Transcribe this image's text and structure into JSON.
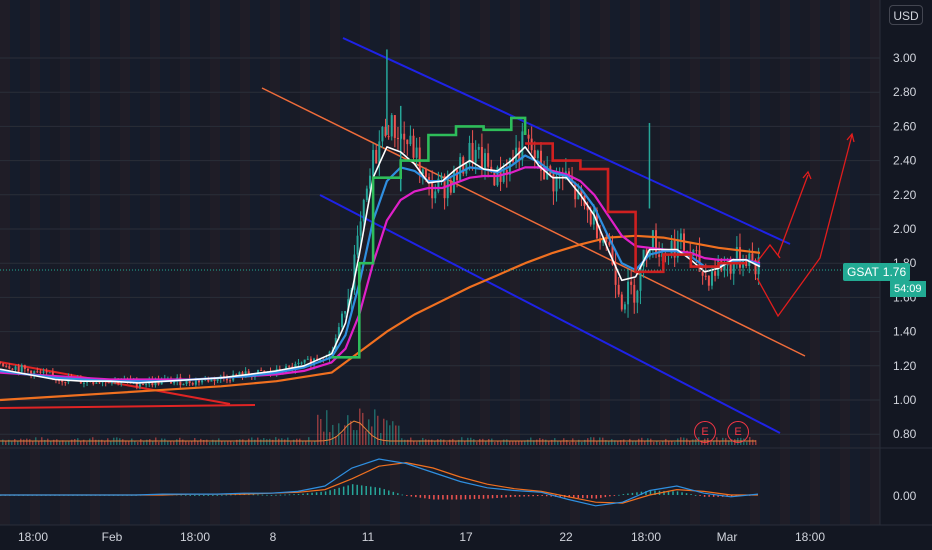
{
  "currency_label": "USD",
  "price_tag": {
    "symbol": "GSAT",
    "value": "1.76",
    "countdown": "54:09"
  },
  "earnings": {
    "label": "E"
  },
  "chart_data": {
    "type": "candlestick",
    "ticker": "GSAT",
    "y_ticks": [
      "3.00",
      "2.80",
      "2.60",
      "2.40",
      "2.20",
      "2.00",
      "1.80",
      "1.60",
      "1.40",
      "1.20",
      "1.00",
      "0.80"
    ],
    "macd_ticks": [
      "0.00"
    ],
    "x_ticks": [
      "18:00",
      "Feb",
      "18:00",
      "8",
      "11",
      "17",
      "22",
      "18:00",
      "Mar",
      "18:00"
    ],
    "ylim": [
      0.75,
      3.1
    ],
    "last_price": 1.76,
    "price_path": [
      [
        0,
        1.22
      ],
      [
        4,
        1.17
      ],
      [
        8,
        1.13
      ],
      [
        12,
        1.11
      ],
      [
        16,
        1.12
      ],
      [
        20,
        1.1
      ],
      [
        24,
        1.11
      ],
      [
        28,
        1.11
      ],
      [
        32,
        1.13
      ],
      [
        36,
        1.15
      ],
      [
        40,
        1.16
      ],
      [
        44,
        1.21
      ],
      [
        48,
        1.28
      ],
      [
        50,
        1.55
      ],
      [
        52,
        1.95
      ],
      [
        54,
        2.4
      ],
      [
        56,
        2.62
      ],
      [
        58,
        2.55
      ],
      [
        60,
        2.45
      ],
      [
        62,
        2.22
      ],
      [
        64,
        2.25
      ],
      [
        66,
        2.3
      ],
      [
        68,
        2.45
      ],
      [
        70,
        2.38
      ],
      [
        72,
        2.3
      ],
      [
        74,
        2.4
      ],
      [
        76,
        2.52
      ],
      [
        78,
        2.38
      ],
      [
        80,
        2.28
      ],
      [
        82,
        2.3
      ],
      [
        84,
        2.15
      ],
      [
        86,
        2.05
      ],
      [
        88,
        1.92
      ],
      [
        90,
        1.6
      ],
      [
        92,
        1.65
      ],
      [
        94,
        1.95
      ],
      [
        96,
        1.86
      ],
      [
        98,
        1.92
      ],
      [
        100,
        1.85
      ],
      [
        102,
        1.72
      ],
      [
        104,
        1.78
      ],
      [
        106,
        1.8
      ],
      [
        108,
        1.85
      ],
      [
        110,
        1.76
      ]
    ],
    "ema_white": [
      [
        0,
        1.18
      ],
      [
        4,
        1.15
      ],
      [
        8,
        1.12
      ],
      [
        12,
        1.11
      ],
      [
        16,
        1.11
      ],
      [
        20,
        1.1
      ],
      [
        24,
        1.11
      ],
      [
        28,
        1.12
      ],
      [
        32,
        1.13
      ],
      [
        36,
        1.15
      ],
      [
        40,
        1.17
      ],
      [
        44,
        1.2
      ],
      [
        48,
        1.27
      ],
      [
        50,
        1.45
      ],
      [
        52,
        1.85
      ],
      [
        54,
        2.3
      ],
      [
        56,
        2.48
      ],
      [
        58,
        2.45
      ],
      [
        60,
        2.38
      ],
      [
        62,
        2.27
      ],
      [
        64,
        2.28
      ],
      [
        66,
        2.35
      ],
      [
        68,
        2.4
      ],
      [
        70,
        2.35
      ],
      [
        72,
        2.34
      ],
      [
        74,
        2.4
      ],
      [
        76,
        2.48
      ],
      [
        78,
        2.37
      ],
      [
        80,
        2.3
      ],
      [
        82,
        2.3
      ],
      [
        84,
        2.2
      ],
      [
        86,
        2.08
      ],
      [
        88,
        1.88
      ],
      [
        90,
        1.7
      ],
      [
        92,
        1.72
      ],
      [
        94,
        1.88
      ],
      [
        96,
        1.88
      ],
      [
        98,
        1.88
      ],
      [
        100,
        1.82
      ],
      [
        102,
        1.75
      ],
      [
        104,
        1.77
      ],
      [
        106,
        1.82
      ],
      [
        108,
        1.82
      ],
      [
        110,
        1.78
      ]
    ],
    "ema_blue": [
      [
        0,
        1.17
      ],
      [
        4,
        1.15
      ],
      [
        8,
        1.13
      ],
      [
        12,
        1.12
      ],
      [
        16,
        1.11
      ],
      [
        20,
        1.11
      ],
      [
        24,
        1.11
      ],
      [
        28,
        1.12
      ],
      [
        32,
        1.13
      ],
      [
        36,
        1.14
      ],
      [
        40,
        1.16
      ],
      [
        44,
        1.19
      ],
      [
        48,
        1.25
      ],
      [
        50,
        1.38
      ],
      [
        52,
        1.68
      ],
      [
        54,
        2.05
      ],
      [
        56,
        2.28
      ],
      [
        58,
        2.36
      ],
      [
        60,
        2.34
      ],
      [
        62,
        2.28
      ],
      [
        64,
        2.28
      ],
      [
        66,
        2.32
      ],
      [
        68,
        2.36
      ],
      [
        70,
        2.35
      ],
      [
        72,
        2.33
      ],
      [
        74,
        2.37
      ],
      [
        76,
        2.43
      ],
      [
        78,
        2.39
      ],
      [
        80,
        2.33
      ],
      [
        82,
        2.31
      ],
      [
        84,
        2.24
      ],
      [
        86,
        2.13
      ],
      [
        88,
        1.96
      ],
      [
        90,
        1.8
      ],
      [
        92,
        1.76
      ],
      [
        94,
        1.85
      ],
      [
        96,
        1.87
      ],
      [
        98,
        1.87
      ],
      [
        100,
        1.84
      ],
      [
        102,
        1.78
      ],
      [
        104,
        1.78
      ],
      [
        106,
        1.81
      ],
      [
        108,
        1.82
      ],
      [
        110,
        1.79
      ]
    ],
    "ema_magenta": [
      [
        0,
        1.16
      ],
      [
        4,
        1.15
      ],
      [
        8,
        1.14
      ],
      [
        12,
        1.13
      ],
      [
        16,
        1.12
      ],
      [
        20,
        1.12
      ],
      [
        24,
        1.12
      ],
      [
        28,
        1.12
      ],
      [
        32,
        1.13
      ],
      [
        36,
        1.14
      ],
      [
        40,
        1.15
      ],
      [
        44,
        1.17
      ],
      [
        48,
        1.22
      ],
      [
        50,
        1.3
      ],
      [
        52,
        1.5
      ],
      [
        54,
        1.8
      ],
      [
        56,
        2.05
      ],
      [
        58,
        2.17
      ],
      [
        60,
        2.22
      ],
      [
        62,
        2.24
      ],
      [
        64,
        2.24
      ],
      [
        66,
        2.27
      ],
      [
        68,
        2.3
      ],
      [
        70,
        2.31
      ],
      [
        72,
        2.31
      ],
      [
        74,
        2.33
      ],
      [
        76,
        2.36
      ],
      [
        78,
        2.36
      ],
      [
        80,
        2.34
      ],
      [
        82,
        2.32
      ],
      [
        84,
        2.28
      ],
      [
        86,
        2.2
      ],
      [
        88,
        2.08
      ],
      [
        90,
        1.96
      ],
      [
        92,
        1.9
      ],
      [
        94,
        1.89
      ],
      [
        96,
        1.88
      ],
      [
        98,
        1.87
      ],
      [
        100,
        1.86
      ],
      [
        102,
        1.83
      ],
      [
        104,
        1.82
      ],
      [
        106,
        1.82
      ],
      [
        108,
        1.82
      ],
      [
        110,
        1.8
      ]
    ],
    "ema_orange": [
      [
        0,
        1.0
      ],
      [
        8,
        1.02
      ],
      [
        16,
        1.04
      ],
      [
        24,
        1.06
      ],
      [
        32,
        1.08
      ],
      [
        40,
        1.11
      ],
      [
        48,
        1.16
      ],
      [
        52,
        1.28
      ],
      [
        56,
        1.4
      ],
      [
        60,
        1.5
      ],
      [
        64,
        1.58
      ],
      [
        68,
        1.66
      ],
      [
        72,
        1.73
      ],
      [
        76,
        1.8
      ],
      [
        80,
        1.86
      ],
      [
        84,
        1.91
      ],
      [
        88,
        1.95
      ],
      [
        92,
        1.96
      ],
      [
        96,
        1.95
      ],
      [
        100,
        1.92
      ],
      [
        104,
        1.89
      ],
      [
        108,
        1.87
      ],
      [
        110,
        1.86
      ]
    ],
    "step_green": [
      [
        48,
        1.25
      ],
      [
        52,
        1.8
      ],
      [
        54,
        2.3
      ],
      [
        58,
        2.4
      ],
      [
        62,
        2.55
      ],
      [
        66,
        2.6
      ],
      [
        70,
        2.58
      ],
      [
        74,
        2.65
      ],
      [
        76,
        2.55
      ]
    ],
    "step_red": [
      [
        76,
        2.5
      ],
      [
        80,
        2.4
      ],
      [
        84,
        2.35
      ],
      [
        88,
        2.1
      ],
      [
        92,
        1.75
      ],
      [
        96,
        1.85
      ],
      [
        100,
        1.78
      ],
      [
        104,
        1.8
      ],
      [
        108,
        1.8
      ]
    ],
    "macd_line": [
      0,
      0,
      0,
      0,
      0,
      0,
      0.01,
      0.01,
      0.01,
      0.02,
      0.02,
      0.04,
      0.1,
      0.3,
      0.4,
      0.35,
      0.25,
      0.15,
      0.08,
      0.05,
      0.03,
      -0.05,
      -0.12,
      -0.08,
      0.05,
      0.1,
      0.02,
      -0.02,
      0.01
    ],
    "macd_signal": [
      0,
      0,
      0,
      0,
      0,
      0,
      0,
      0.01,
      0.01,
      0.01,
      0.02,
      0.03,
      0.06,
      0.18,
      0.32,
      0.36,
      0.3,
      0.2,
      0.12,
      0.07,
      0.04,
      -0.02,
      -0.08,
      -0.09,
      0.0,
      0.06,
      0.04,
      0.0,
      0.0
    ]
  }
}
